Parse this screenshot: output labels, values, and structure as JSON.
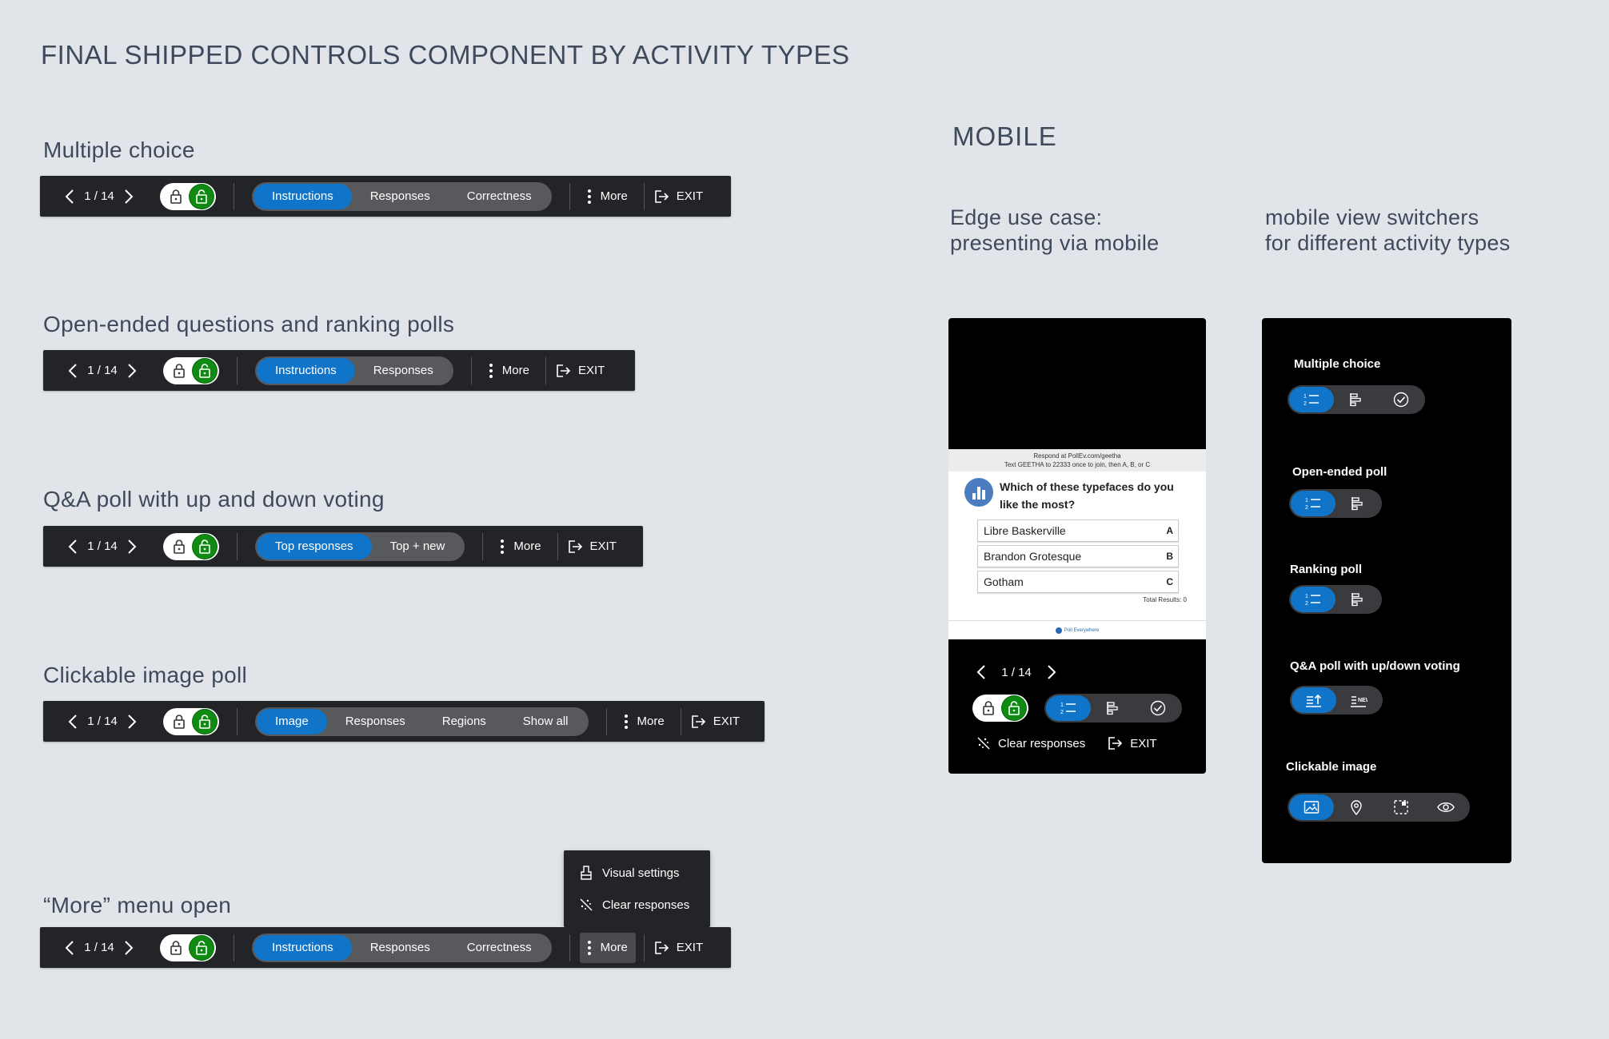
{
  "title": "FINAL SHIPPED CONTROLS COMPONENT BY ACTIVITY TYPES",
  "pager": "1 / 14",
  "more_label": "More",
  "exit_label": "EXIT",
  "sections": {
    "multiple_choice": {
      "label": "Multiple choice",
      "tabs": [
        "Instructions",
        "Responses",
        "Correctness"
      ]
    },
    "open_ended": {
      "label": "Open-ended questions and ranking polls",
      "tabs": [
        "Instructions",
        "Responses"
      ]
    },
    "qa": {
      "label": "Q&A poll with up and down voting",
      "tabs": [
        "Top responses",
        "Top + new"
      ]
    },
    "clickable": {
      "label": "Clickable image poll",
      "tabs": [
        "Image",
        "Responses",
        "Regions",
        "Show all"
      ]
    },
    "more_open": {
      "label": "“More” menu open",
      "tabs": [
        "Instructions",
        "Responses",
        "Correctness"
      ]
    }
  },
  "more_menu": {
    "items": [
      "Visual settings",
      "Clear responses"
    ]
  },
  "mobile": {
    "heading": "MOBILE",
    "edge_case": [
      "Edge use case:",
      "presenting via mobile"
    ],
    "switchers_heading": [
      "mobile view switchers",
      "for different activity types"
    ],
    "slide": {
      "respond_line": "Respond at PollEv.com/geetha",
      "text_line": "Text GEETHA to 22333 once to join, then A, B, or C",
      "question": "Which of these typefaces do you like the most?",
      "options": [
        {
          "label": "Libre Baskerville",
          "key": "A"
        },
        {
          "label": "Brandon Grotesque",
          "key": "B"
        },
        {
          "label": "Gotham",
          "key": "C"
        }
      ],
      "total": "Total Results: 0",
      "footer": "Poll Everywhere"
    },
    "clear_responses": "Clear responses"
  },
  "switchers": [
    {
      "label": "Multiple choice",
      "icons": [
        "numbered-list-icon",
        "bar-chart-icon",
        "check-circle-icon"
      ]
    },
    {
      "label": "Open-ended poll",
      "icons": [
        "numbered-list-icon",
        "bar-chart-icon"
      ]
    },
    {
      "label": "Ranking poll",
      "icons": [
        "numbered-list-icon",
        "bar-chart-icon"
      ]
    },
    {
      "label": "Q&A poll with up/down voting",
      "icons": [
        "top-responses-icon",
        "new-responses-icon"
      ]
    },
    {
      "label": "Clickable image",
      "icons": [
        "image-icon",
        "location-pin-icon",
        "region-select-icon",
        "eye-icon"
      ]
    }
  ],
  "colors": {
    "background": "#e1e4e9",
    "toolbar": "#232427",
    "accent": "#1075c9",
    "lock_green": "#0f8a12"
  }
}
